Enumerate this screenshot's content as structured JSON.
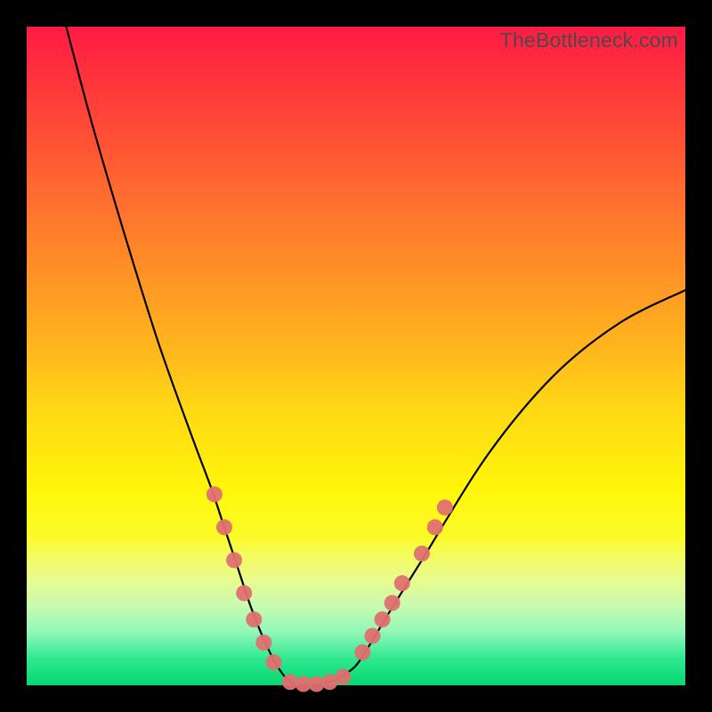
{
  "watermark": "TheBottleneck.com",
  "chart_data": {
    "type": "line",
    "title": "",
    "xlabel": "",
    "ylabel": "",
    "xlim": [
      0,
      100
    ],
    "ylim": [
      0,
      100
    ],
    "background_gradient": [
      "#ff1a44",
      "#ff9a24",
      "#fff60a",
      "#05d770"
    ],
    "series": [
      {
        "name": "bottleneck-curve",
        "x": [
          6,
          10,
          15,
          20,
          25,
          28,
          30,
          32,
          34,
          36,
          38,
          40,
          42,
          44,
          46,
          48,
          50,
          52,
          55,
          60,
          70,
          80,
          90,
          100
        ],
        "y": [
          100,
          85,
          68,
          52,
          38,
          30,
          24,
          18,
          12,
          7,
          3,
          0.5,
          0,
          0,
          0.5,
          1.5,
          3,
          6,
          11,
          19,
          35,
          47,
          55,
          60
        ]
      }
    ],
    "markers": {
      "name": "highlight-points",
      "left_descent": [
        {
          "x": 28.5,
          "y": 29
        },
        {
          "x": 30.0,
          "y": 24
        },
        {
          "x": 31.5,
          "y": 19
        },
        {
          "x": 33.0,
          "y": 14
        },
        {
          "x": 34.5,
          "y": 10
        },
        {
          "x": 36.0,
          "y": 6.5
        },
        {
          "x": 37.5,
          "y": 3.5
        }
      ],
      "trough": [
        {
          "x": 40,
          "y": 0.5
        },
        {
          "x": 42,
          "y": 0.2
        },
        {
          "x": 44,
          "y": 0.2
        },
        {
          "x": 46,
          "y": 0.5
        },
        {
          "x": 48,
          "y": 1.3
        }
      ],
      "right_ascent": [
        {
          "x": 51.0,
          "y": 5
        },
        {
          "x": 52.5,
          "y": 7.5
        },
        {
          "x": 54.0,
          "y": 10
        },
        {
          "x": 55.5,
          "y": 12.5
        },
        {
          "x": 57.0,
          "y": 15.5
        },
        {
          "x": 60.0,
          "y": 20
        },
        {
          "x": 62.0,
          "y": 24
        },
        {
          "x": 63.5,
          "y": 27
        }
      ]
    },
    "marker_radius_px": 9
  }
}
